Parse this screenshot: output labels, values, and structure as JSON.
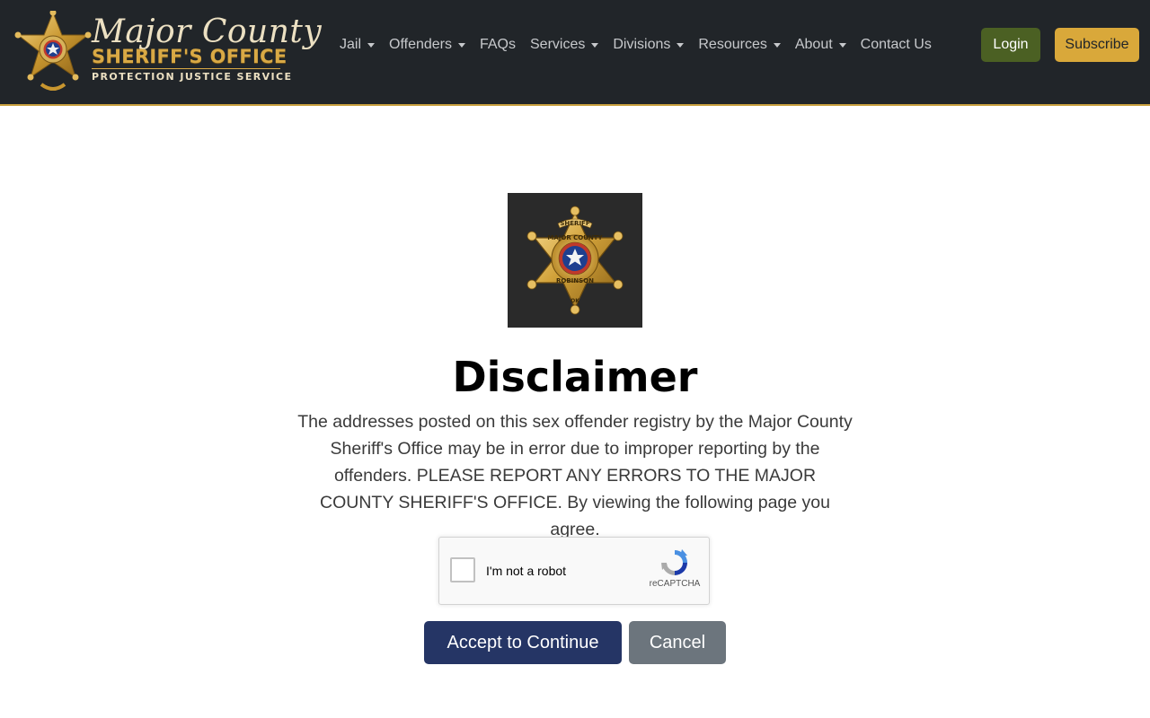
{
  "header": {
    "logo": {
      "script_text": "Major County",
      "office_text": "SHERIFF'S OFFICE",
      "motto": "PROTECTION  JUSTICE  SERVICE"
    },
    "nav": [
      {
        "label": "Jail",
        "dropdown": true
      },
      {
        "label": "Offenders",
        "dropdown": true
      },
      {
        "label": "FAQs",
        "dropdown": false
      },
      {
        "label": "Services",
        "dropdown": true
      },
      {
        "label": "Divisions",
        "dropdown": true
      },
      {
        "label": "Resources",
        "dropdown": true
      },
      {
        "label": "About",
        "dropdown": true
      },
      {
        "label": "Contact Us",
        "dropdown": false
      }
    ],
    "login_label": "Login",
    "subscribe_label": "Subscribe"
  },
  "main": {
    "badge_text": {
      "top": "SHERIFF",
      "middle": "MAJOR COUNTY",
      "bottom": "ROBINSON",
      "state": "OK"
    },
    "title": "Disclaimer",
    "body": "The addresses posted on this sex offender registry by the Major County Sheriff's Office may be in error due to improper reporting by the offenders. PLEASE REPORT ANY ERRORS TO THE MAJOR COUNTY SHERIFF'S OFFICE. By viewing the following page you agree.",
    "recaptcha": {
      "label": "I'm not a robot",
      "brand": "reCAPTCHA",
      "checked": false
    },
    "accept_label": "Accept to Continue",
    "cancel_label": "Cancel"
  },
  "colors": {
    "header_bg": "#212529",
    "accent_gold": "#d9a83a",
    "login_green": "#4b6023",
    "accept_navy": "#253565",
    "cancel_gray": "#6c757d"
  }
}
